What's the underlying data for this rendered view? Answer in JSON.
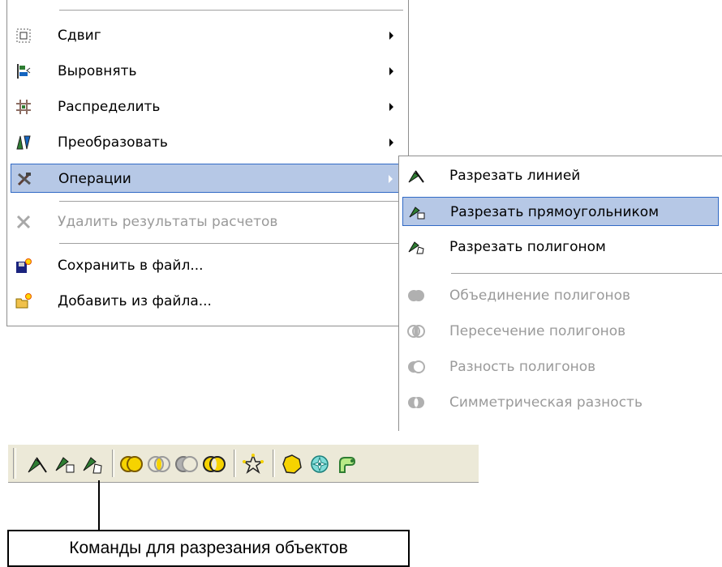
{
  "main_menu": {
    "items": [
      {
        "label": "Сдвиг",
        "icon": "move-icon"
      },
      {
        "label": "Выровнять",
        "icon": "align-icon"
      },
      {
        "label": "Распределить",
        "icon": "distribute-icon"
      },
      {
        "label": "Преобразовать",
        "icon": "transform-icon"
      },
      {
        "label": "Операции",
        "icon": "tools-icon"
      },
      {
        "label": "Удалить результаты расчетов",
        "icon": "delete-icon"
      },
      {
        "label": "Сохранить в файл...",
        "icon": "save-file-icon"
      },
      {
        "label": "Добавить из файла...",
        "icon": "open-file-icon"
      }
    ]
  },
  "submenu": {
    "items": [
      {
        "label": "Разрезать линией",
        "icon": "cut-line-icon"
      },
      {
        "label": "Разрезать прямоугольником",
        "icon": "cut-rectangle-icon"
      },
      {
        "label": "Разрезать полигоном",
        "icon": "cut-polygon-icon"
      },
      {
        "label": "Объединение полигонов",
        "icon": "union-icon"
      },
      {
        "label": "Пересечение полигонов",
        "icon": "intersection-icon"
      },
      {
        "label": "Разность полигонов",
        "icon": "difference-icon"
      },
      {
        "label": "Симметрическая разность",
        "icon": "symmetric-difference-icon"
      }
    ]
  },
  "toolbar": {
    "buttons": [
      "cut-line-icon",
      "cut-rectangle-icon",
      "cut-polygon-icon",
      "union-icon",
      "intersection-icon",
      "difference-icon",
      "symmetric-difference-icon",
      "star-icon",
      "polygon-icon",
      "gear-icon",
      "route-icon"
    ]
  },
  "callout": {
    "text": "Команды для разрезания объектов"
  },
  "colors": {
    "highlight": "#b6c8e6",
    "highlight_border": "#316ac5",
    "disabled_text": "#9a9a9a"
  }
}
